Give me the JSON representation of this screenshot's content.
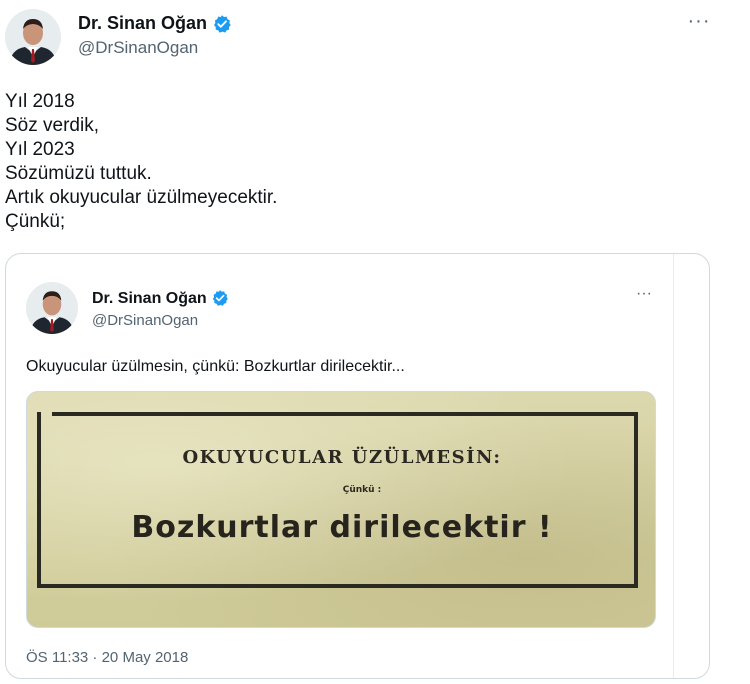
{
  "tweet": {
    "author_name": "Dr. Sinan Oğan",
    "author_handle": "@DrSinanOgan",
    "more_label": "···",
    "body_lines": [
      "Yıl 2018",
      "Söz verdik,",
      "Yıl 2023",
      "Sözümüzü tuttuk.",
      "Artık okuyucular üzülmeyecektir.",
      "Çünkü;"
    ]
  },
  "quoted_tweet": {
    "author_name": "Dr. Sinan Oğan",
    "author_handle": "@DrSinanOgan",
    "more_label": "···",
    "text": "Okuyucular üzülmesin, çünkü: Bozkurtlar dirilecektir...",
    "media": {
      "headline": "OKUYUCULAR ÜZÜLMESİN:",
      "subline": "Çünkü :",
      "main": "Bozkurtlar dirilecektir !"
    },
    "timestamp": "ÖS 11:33 · 20 May 2018"
  },
  "colors": {
    "verified_badge": "#1d9bf0",
    "secondary_text": "#536471",
    "border": "#cfd9de"
  },
  "icons": {
    "verified": "verified-badge-icon",
    "more": "more-options-icon"
  }
}
